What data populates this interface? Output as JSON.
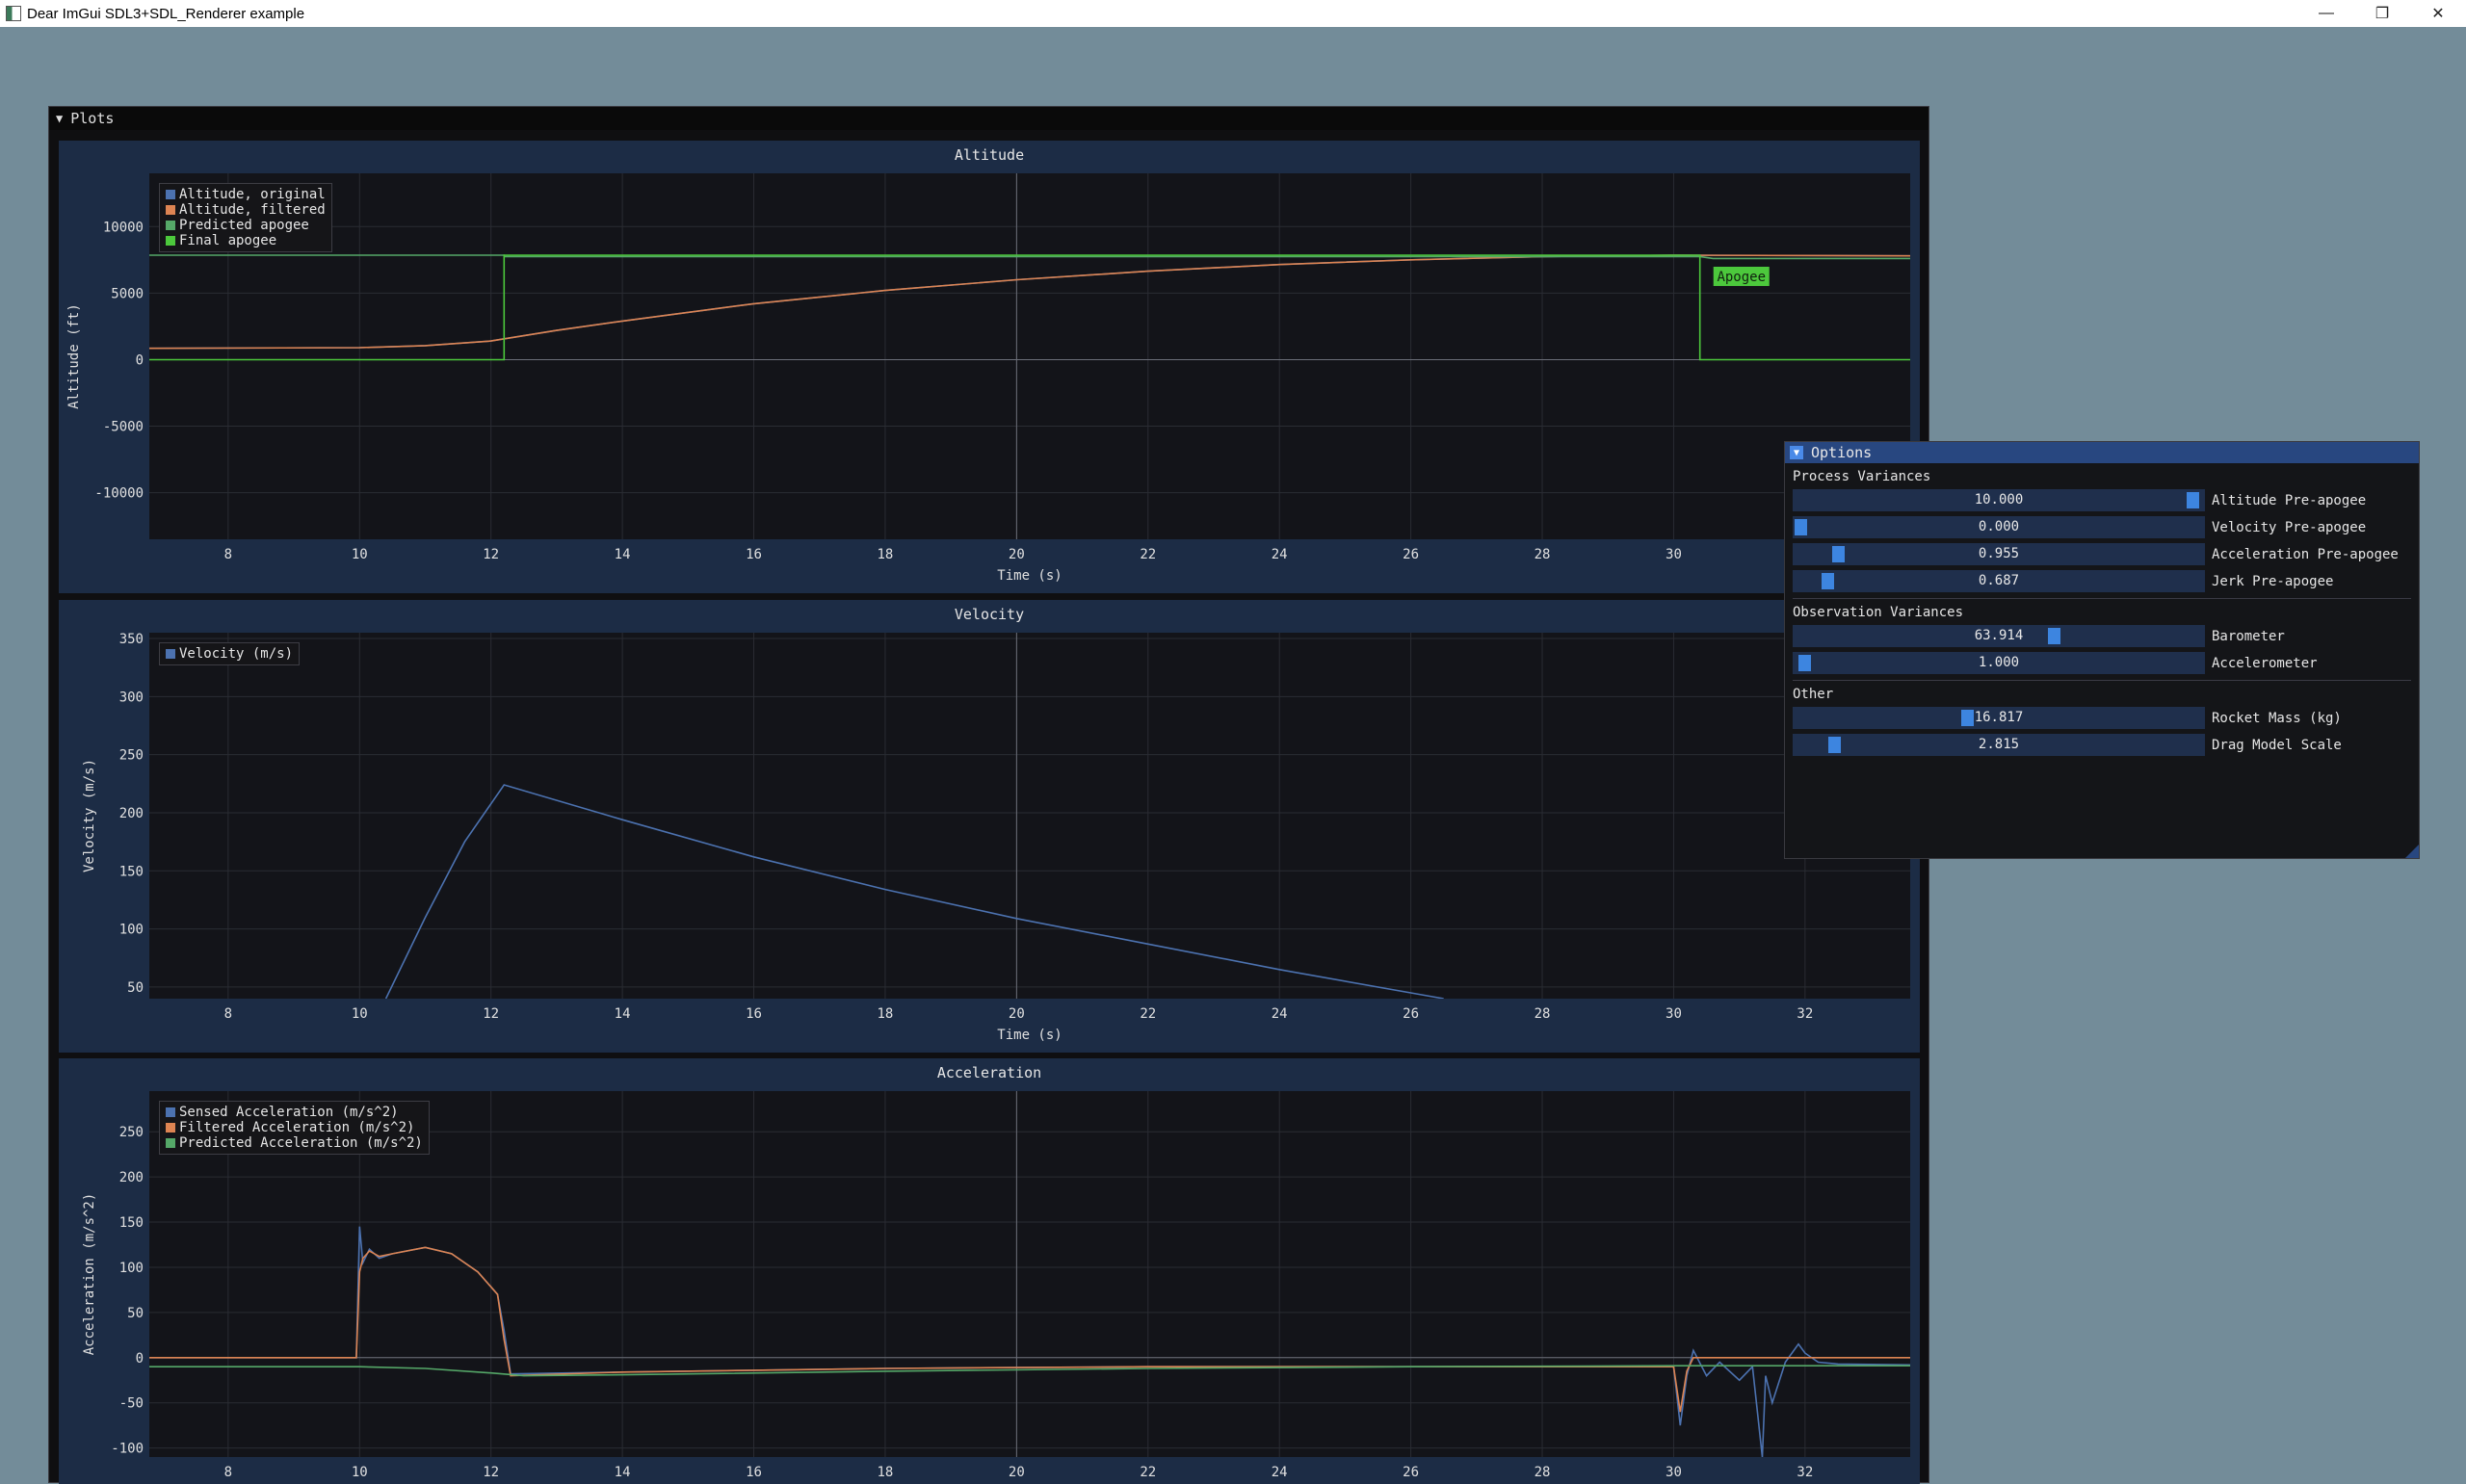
{
  "os_window": {
    "title": "Dear ImGui SDL3+SDL_Renderer example",
    "minimize": "—",
    "restore": "❐",
    "close": "✕"
  },
  "plots_window": {
    "title": "Plots",
    "collapse_glyph": "▼"
  },
  "plots": [
    {
      "id": "altitude",
      "title": "Altitude",
      "xlabel": "Time (s)",
      "ylabel": "Altitude (ft)",
      "legend": [
        "Altitude, original",
        "Altitude, filtered",
        "Predicted apogee",
        "Final apogee"
      ],
      "annotation": "Apogee"
    },
    {
      "id": "velocity",
      "title": "Velocity",
      "xlabel": "Time (s)",
      "ylabel": "Velocity (m/s)",
      "legend": [
        "Velocity (m/s)"
      ]
    },
    {
      "id": "acceleration",
      "title": "Acceleration",
      "xlabel": "",
      "ylabel": "Acceleration (m/s^2)",
      "legend": [
        "Sensed Acceleration (m/s^2)",
        "Filtered Acceleration (m/s^2)",
        "Predicted Acceleration (m/s^2)"
      ]
    }
  ],
  "options_window": {
    "title": "Options",
    "collapse_glyph": "▼",
    "sections": [
      {
        "header": "Process Variances",
        "sliders": [
          {
            "value": "10.000",
            "label": "Altitude Pre-apogee",
            "fraction": 0.99
          },
          {
            "value": "0.000",
            "label": "Velocity Pre-apogee",
            "fraction": 0.0
          },
          {
            "value": "0.955",
            "label": "Acceleration Pre-apogee",
            "fraction": 0.095
          },
          {
            "value": "0.687",
            "label": "Jerk Pre-apogee",
            "fraction": 0.069
          }
        ]
      },
      {
        "header": "Observation Variances",
        "sliders": [
          {
            "value": "63.914",
            "label": "Barometer",
            "fraction": 0.64
          },
          {
            "value": "1.000",
            "label": "Accelerometer",
            "fraction": 0.01
          }
        ]
      },
      {
        "header": "Other",
        "sliders": [
          {
            "value": "16.817",
            "label": "Rocket Mass (kg)",
            "fraction": 0.42
          },
          {
            "value": "2.815",
            "label": "Drag Model Scale",
            "fraction": 0.085
          }
        ]
      }
    ]
  },
  "colors": {
    "series_blue": "#4c72b0",
    "series_orange": "#dd8452",
    "series_green": "#55a868",
    "series_bright_green": "#4cc83c",
    "accent": "#3d85e0",
    "plot_bg": "#131419",
    "frame_bg": "#1c2c45"
  },
  "chart_data": [
    {
      "type": "line",
      "title": "Altitude",
      "xlabel": "Time (s)",
      "ylabel": "Altitude (ft)",
      "xlim": [
        6.8,
        33.6
      ],
      "ylim": [
        -13500,
        14000
      ],
      "xticks": [
        8,
        10,
        12,
        14,
        16,
        18,
        20,
        22,
        24,
        26,
        28,
        30
      ],
      "yticks": [
        10000,
        5000,
        0,
        -5000,
        -10000
      ],
      "series": [
        {
          "name": "Altitude, original",
          "x": [
            6.8,
            10,
            11,
            12,
            13,
            14,
            16,
            18,
            20,
            22,
            24,
            26,
            28,
            30,
            33.6
          ],
          "y": [
            850,
            900,
            1050,
            1400,
            2200,
            2900,
            4200,
            5200,
            6000,
            6650,
            7150,
            7500,
            7750,
            7850,
            7800
          ]
        },
        {
          "name": "Altitude, filtered",
          "x": [
            6.8,
            10,
            11,
            12,
            13,
            14,
            16,
            18,
            20,
            22,
            24,
            26,
            28,
            30,
            33.6
          ],
          "y": [
            850,
            900,
            1050,
            1400,
            2200,
            2900,
            4200,
            5200,
            6000,
            6650,
            7150,
            7500,
            7750,
            7850,
            7800
          ]
        },
        {
          "name": "Predicted apogee",
          "x": [
            6.8,
            12.2,
            12.2,
            30.4,
            30.6,
            33.6
          ],
          "y": [
            7850,
            7850,
            7750,
            7750,
            7600,
            7600
          ]
        },
        {
          "name": "Final apogee",
          "x": [
            6.8,
            12.2,
            12.2,
            30.4,
            30.4,
            33.6
          ],
          "y": [
            0,
            0,
            7850,
            7850,
            0,
            0
          ]
        }
      ]
    },
    {
      "type": "line",
      "title": "Velocity",
      "xlabel": "Time (s)",
      "ylabel": "Velocity (m/s)",
      "xlim": [
        6.8,
        33.6
      ],
      "ylim": [
        40,
        355
      ],
      "xticks": [
        8,
        10,
        12,
        14,
        16,
        18,
        20,
        22,
        24,
        26,
        28,
        30,
        32
      ],
      "yticks": [
        350,
        300,
        250,
        200,
        150,
        100,
        50
      ],
      "series": [
        {
          "name": "Velocity (m/s)",
          "x": [
            10.4,
            11.0,
            11.6,
            12.2,
            14,
            16,
            18,
            20,
            22,
            24,
            26,
            26.5
          ],
          "y": [
            40,
            110,
            175,
            224,
            194,
            162,
            134,
            109,
            87,
            65,
            45,
            40
          ]
        }
      ]
    },
    {
      "type": "line",
      "title": "Acceleration",
      "xlabel": "",
      "ylabel": "Acceleration (m/s^2)",
      "xlim": [
        6.8,
        33.6
      ],
      "ylim": [
        -110,
        295
      ],
      "xticks": [
        8,
        10,
        12,
        14,
        16,
        18,
        20,
        22,
        24,
        26,
        28,
        30,
        32
      ],
      "yticks": [
        250,
        200,
        150,
        100,
        50,
        0,
        -50,
        -100
      ],
      "series": [
        {
          "name": "Sensed Acceleration (m/s^2)",
          "x": [
            6.8,
            9.95,
            10.0,
            10.05,
            10.15,
            10.3,
            10.5,
            11.0,
            11.4,
            11.8,
            12.1,
            12.2,
            12.3,
            14,
            16,
            18,
            20,
            22,
            24,
            26,
            28,
            30.0,
            30.1,
            30.2,
            30.3,
            30.5,
            30.7,
            31.0,
            31.2,
            31.35,
            31.4,
            31.5,
            31.7,
            31.9,
            32.0,
            32.2,
            32.5,
            33.6
          ],
          "y": [
            0,
            0,
            145,
            105,
            120,
            110,
            115,
            122,
            115,
            95,
            70,
            30,
            -18,
            -16,
            -14,
            -12,
            -11,
            -10,
            -10,
            -10,
            -10,
            -10,
            -75,
            -20,
            8,
            -20,
            -5,
            -25,
            -10,
            -110,
            -20,
            -50,
            -5,
            15,
            5,
            -5,
            -7,
            -8
          ]
        },
        {
          "name": "Filtered Acceleration (m/s^2)",
          "x": [
            6.8,
            9.95,
            10.0,
            10.05,
            10.15,
            10.3,
            10.5,
            11.0,
            11.4,
            11.8,
            12.1,
            12.2,
            12.3,
            14,
            16,
            18,
            20,
            22,
            24,
            26,
            28,
            30.0,
            30.1,
            30.2,
            30.3,
            30.6,
            33.6
          ],
          "y": [
            0,
            0,
            95,
            110,
            118,
            112,
            115,
            122,
            115,
            95,
            70,
            20,
            -20,
            -16,
            -14,
            -12,
            -11,
            -10,
            -10,
            -10,
            -10,
            -10,
            -60,
            -15,
            0,
            0,
            0
          ]
        },
        {
          "name": "Predicted Acceleration (m/s^2)",
          "x": [
            6.8,
            10,
            11,
            12,
            12.5,
            14,
            18,
            22,
            26,
            30,
            33.6
          ],
          "y": [
            -10,
            -10,
            -12,
            -17,
            -20,
            -19,
            -15,
            -12,
            -10,
            -9,
            -9
          ]
        }
      ]
    }
  ]
}
